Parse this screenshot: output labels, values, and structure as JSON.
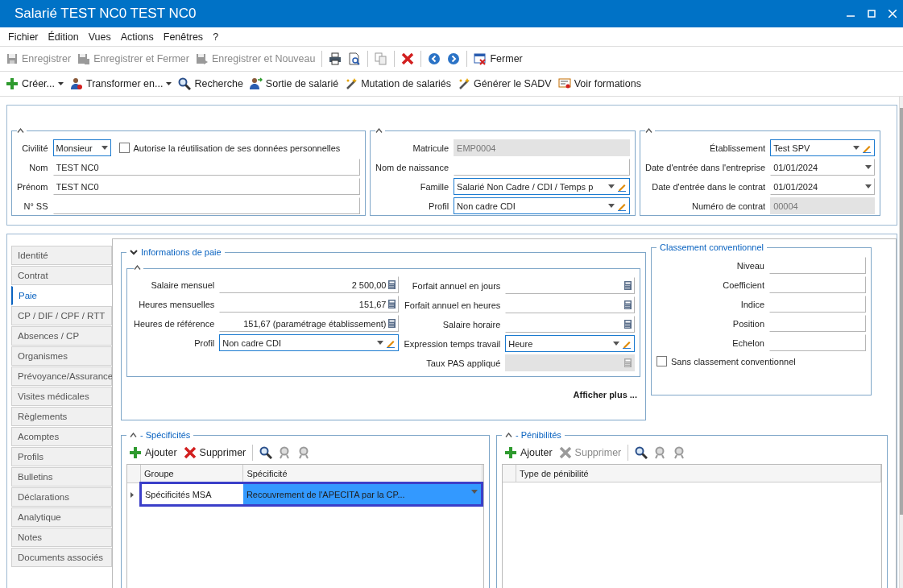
{
  "window": {
    "title": "Salarié TEST NC0 TEST NC0"
  },
  "menu": [
    "Fichier",
    "Édition",
    "Vues",
    "Actions",
    "Fenêtres",
    "?"
  ],
  "toolbar": [
    {
      "kind": "save",
      "label": "Enregistrer",
      "disabled": true
    },
    {
      "kind": "save-close",
      "label": "Enregistrer et Fermer",
      "disabled": true
    },
    {
      "kind": "save-new",
      "label": "Enregistrer et Nouveau",
      "disabled": true
    },
    {
      "kind": "separator"
    },
    {
      "kind": "print",
      "disabled": false
    },
    {
      "kind": "preview",
      "disabled": false
    },
    {
      "kind": "separator"
    },
    {
      "kind": "copy",
      "disabled": true
    },
    {
      "kind": "separator"
    },
    {
      "kind": "delete",
      "disabled": false
    },
    {
      "kind": "separator"
    },
    {
      "kind": "back",
      "disabled": false
    },
    {
      "kind": "forward",
      "disabled": false
    },
    {
      "kind": "separator"
    },
    {
      "kind": "close",
      "label": "Fermer",
      "disabled": false
    }
  ],
  "actions": [
    {
      "kind": "create",
      "label": "Créer...",
      "dropdown": true
    },
    {
      "kind": "transform",
      "label": "Transformer en...",
      "dropdown": true
    },
    {
      "kind": "search",
      "label": "Recherche",
      "dropdown": false
    },
    {
      "kind": "exit",
      "label": "Sortie de salarié",
      "dropdown": false
    },
    {
      "kind": "wand",
      "label": "Mutation de salariés",
      "dropdown": false
    },
    {
      "kind": "wand",
      "label": "Générer le SADV",
      "dropdown": false
    },
    {
      "kind": "certificate",
      "label": "Voir formations",
      "dropdown": false
    }
  ],
  "identity": {
    "civility": {
      "label": "Civilité",
      "value": "Monsieur"
    },
    "consent": {
      "label": "Autorise la réutilisation de ses données personnelles",
      "checked": false
    },
    "fields": [
      {
        "label": "Nom",
        "value": "TEST NC0"
      },
      {
        "label": "Prénom",
        "value": "TEST NC0"
      },
      {
        "label": "N° SS"
      }
    ]
  },
  "registration": {
    "fields": [
      {
        "label": "Matricule",
        "kind": "readonly",
        "value": "EMP0004"
      },
      {
        "label": "Nom de naissance",
        "kind": "text"
      },
      {
        "label": "Famille",
        "kind": "select-edit",
        "value": "Salarié Non Cadre / CDI / Temps p"
      },
      {
        "label": "Profil",
        "kind": "select-edit",
        "value": "Non cadre CDI"
      }
    ]
  },
  "establishment": {
    "fields": [
      {
        "label": "Établissement",
        "kind": "select-edit",
        "value": "Test SPV"
      },
      {
        "label": "Date d'entrée dans l'entreprise",
        "kind": "date",
        "value": "01/01/2024"
      },
      {
        "label": "Date d'entrée dans le contrat",
        "kind": "date",
        "value": "01/01/2024"
      },
      {
        "label": "Numéro de contrat",
        "kind": "readonly",
        "value": "00004"
      }
    ]
  },
  "side_tabs": [
    {
      "label": "Identité",
      "selected": false
    },
    {
      "label": "Contrat",
      "selected": false
    },
    {
      "label": "Paie",
      "selected": true
    },
    {
      "label": "CP / DIF / CPF / RTT",
      "selected": false
    },
    {
      "label": "Absences / CP",
      "selected": false
    },
    {
      "label": "Organismes",
      "selected": false
    },
    {
      "label": "Prévoyance/Assurance",
      "selected": false
    },
    {
      "label": "Visites médicales",
      "selected": false
    },
    {
      "label": "Règlements",
      "selected": false
    },
    {
      "label": "Acomptes",
      "selected": false
    },
    {
      "label": "Profils",
      "selected": false
    },
    {
      "label": "Bulletins",
      "selected": false
    },
    {
      "label": "Déclarations",
      "selected": false
    },
    {
      "label": "Analytique",
      "selected": false
    },
    {
      "label": "Notes",
      "selected": false
    },
    {
      "label": "Documents associés",
      "selected": false
    }
  ],
  "pay": {
    "title": "Informations de paie",
    "expanded": true,
    "left": [
      {
        "label": "Salaire mensuel",
        "kind": "calc",
        "value": "2 500,00"
      },
      {
        "label": "Heures mensuelles",
        "kind": "calc",
        "value": "151,67"
      },
      {
        "label": "Heures de référence",
        "kind": "calc",
        "value": "151,67 (paramétrage établissement)"
      },
      {
        "label": "Profil",
        "kind": "select-edit",
        "value": "Non cadre CDI"
      }
    ],
    "right": [
      {
        "label": "Forfait annuel en jours",
        "kind": "calc"
      },
      {
        "label": "Forfait annuel en heures",
        "kind": "calc"
      },
      {
        "label": "Salaire horaire",
        "kind": "calc"
      },
      {
        "label": "Expression temps travail",
        "kind": "select-edit",
        "value": "Heure"
      },
      {
        "label": "Taux PAS appliqué",
        "kind": "calc-readonly"
      }
    ],
    "more": "Afficher plus ..."
  },
  "classification": {
    "title": "Classement conventionnel",
    "fields": [
      {
        "label": "Niveau"
      },
      {
        "label": "Coefficient"
      },
      {
        "label": "Indice"
      },
      {
        "label": "Position"
      },
      {
        "label": "Echelon"
      }
    ],
    "none": {
      "label": "Sans classement conventionnel",
      "checked": false
    }
  },
  "specifics": {
    "title": "- Spécificités",
    "actions": [
      {
        "kind": "add",
        "label": "Ajouter",
        "disabled": false
      },
      {
        "kind": "delete",
        "label": "Supprimer",
        "disabled": false
      },
      {
        "kind": "separator"
      },
      {
        "kind": "zoom",
        "disabled": false
      },
      {
        "kind": "zoom-in",
        "disabled": true
      },
      {
        "kind": "zoom-out",
        "disabled": true
      }
    ],
    "columns": [
      "Groupe",
      "Spécificité"
    ],
    "rows": [
      {
        "cells": [
          "Spécificités MSA",
          "Recouvrement de l'APECITA par la CP..."
        ],
        "selected": true
      }
    ]
  },
  "hardship": {
    "title": "- Pénibilités",
    "actions": [
      {
        "kind": "add",
        "label": "Ajouter",
        "disabled": false
      },
      {
        "kind": "delete",
        "label": "Supprimer",
        "disabled": true
      },
      {
        "kind": "separator"
      },
      {
        "kind": "zoom",
        "disabled": false
      },
      {
        "kind": "zoom-in",
        "disabled": true
      },
      {
        "kind": "zoom-out",
        "disabled": true
      }
    ],
    "columns": [
      "Type de pénibilité"
    ]
  }
}
